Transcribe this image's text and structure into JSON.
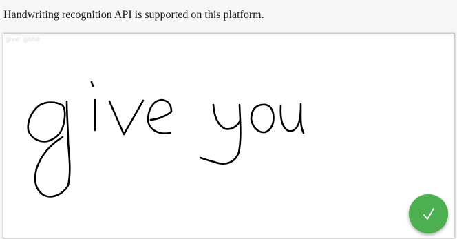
{
  "status": {
    "message": "Handwriting recognition API is supported on this platform."
  },
  "canvas": {
    "recognized_text": "give' gone"
  },
  "confirm_button": {
    "icon": "checkmark-icon",
    "color": "#4caf50"
  }
}
